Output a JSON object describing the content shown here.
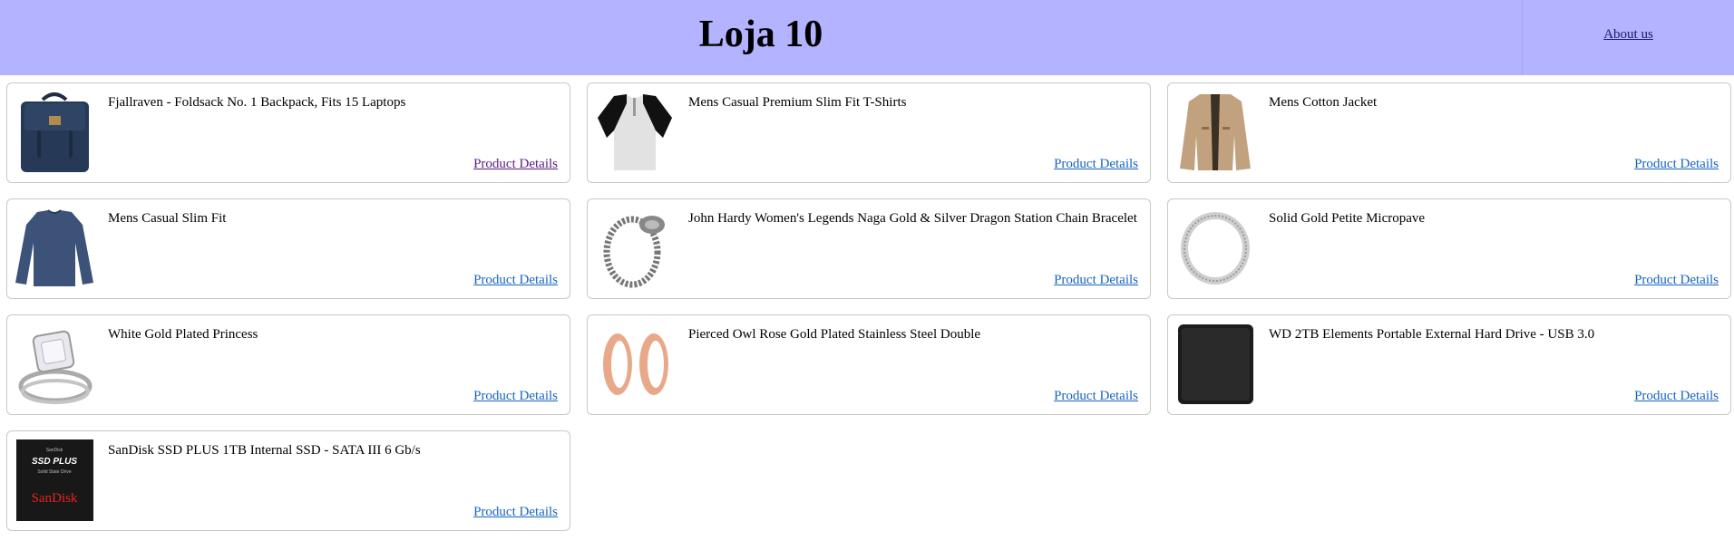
{
  "header": {
    "title": "Loja 10",
    "about_label": "About us"
  },
  "products": [
    {
      "name": "Fjallraven - Foldsack No. 1 Backpack, Fits 15 Laptops",
      "link_label": "Product Details",
      "icon": "backpack-icon"
    },
    {
      "name": "Mens Casual Premium Slim Fit T-Shirts",
      "link_label": "Product Details",
      "icon": "tshirt-icon"
    },
    {
      "name": "Mens Cotton Jacket",
      "link_label": "Product Details",
      "icon": "jacket-icon"
    },
    {
      "name": "Mens Casual Slim Fit",
      "link_label": "Product Details",
      "icon": "longsleeve-icon"
    },
    {
      "name": "John Hardy Women's Legends Naga Gold & Silver Dragon Station Chain Bracelet",
      "link_label": "Product Details",
      "icon": "bracelet-icon"
    },
    {
      "name": "Solid Gold Petite Micropave",
      "link_label": "Product Details",
      "icon": "ring-icon"
    },
    {
      "name": "White Gold Plated Princess",
      "link_label": "Product Details",
      "icon": "diamond-ring-icon"
    },
    {
      "name": "Pierced Owl Rose Gold Plated Stainless Steel Double",
      "link_label": "Product Details",
      "icon": "earrings-icon"
    },
    {
      "name": "WD 2TB Elements Portable External Hard Drive - USB 3.0",
      "link_label": "Product Details",
      "icon": "hard-drive-icon"
    },
    {
      "name": "SanDisk SSD PLUS 1TB Internal SSD - SATA III 6 Gb/s",
      "link_label": "Product Details",
      "icon": "ssd-icon",
      "image_text": {
        "top": "SanDisk",
        "model": "SSD PLUS",
        "sub": "Solid State Drive",
        "brand": "SanDisk"
      }
    }
  ]
}
